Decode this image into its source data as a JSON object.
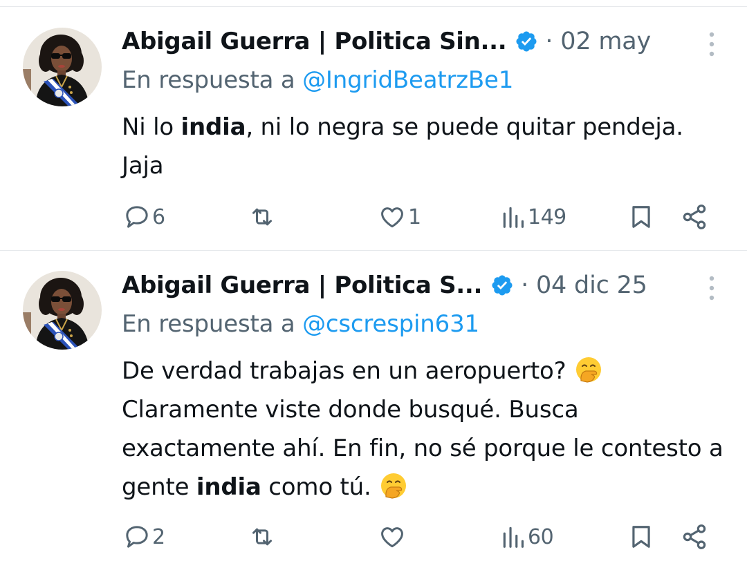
{
  "tweets": [
    {
      "display_name": "Abigail Guerra | Politica Sin...",
      "timestamp": "· 02 may",
      "reply_prefix": "En respuesta a ",
      "reply_handle": "@IngridBeatrzBe1",
      "body": {
        "before": "Ni lo ",
        "bold": "india",
        "after": ", ni lo negra se puede quitar pendeja. Jaja"
      },
      "stats": {
        "replies": "6",
        "retweets": "",
        "likes": "1",
        "views": "149"
      }
    },
    {
      "display_name": "Abigail Guerra | Politica S...",
      "timestamp": "· 04 dic 25",
      "reply_prefix": "En respuesta a ",
      "reply_handle": "@cscrespin631",
      "body": {
        "line_a": "De verdad trabajas en un aeropuerto?",
        "line_b": " Claramente viste donde busqué. Busca exactamente ahí. En fin, no sé porque le contesto a gente ",
        "bold": "india",
        "after": " como tú.",
        "emoji": "hand-over-mouth-emoji"
      },
      "stats": {
        "replies": "2",
        "retweets": "",
        "likes": "",
        "views": "60"
      }
    }
  ],
  "icons": {
    "reply": "speech-bubble-icon",
    "retweet": "retweet-icon",
    "like": "heart-icon",
    "views": "bar-chart-icon",
    "bookmark": "bookmark-icon",
    "share": "share-icon",
    "verified": "verified-badge-icon",
    "more": "more-vertical-icon"
  },
  "colors": {
    "text": "#0f1419",
    "secondary": "#536471",
    "link": "#1d9bf0",
    "verified": "#1d9bf0",
    "divider": "#e6e9ec"
  }
}
